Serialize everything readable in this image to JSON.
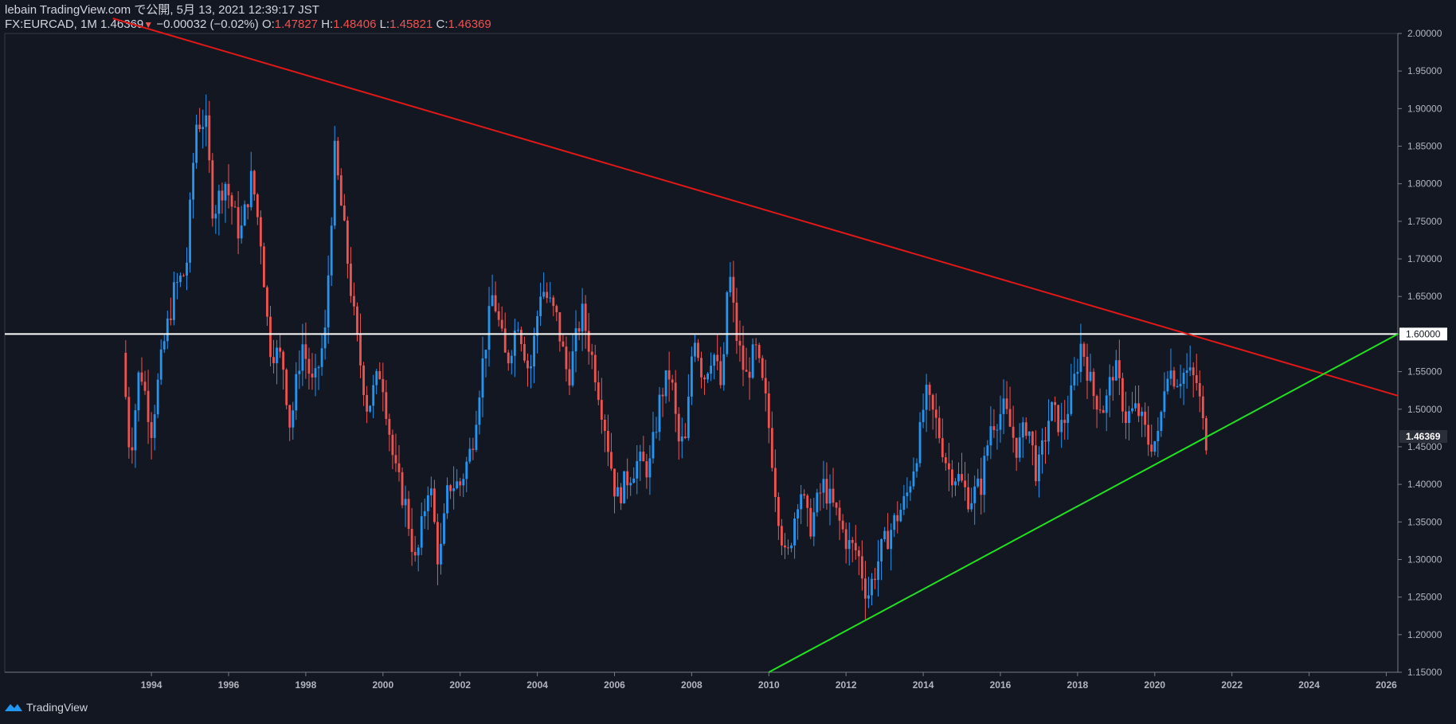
{
  "header": {
    "line1": "lebain TradingView.com で公開, 5月 13, 2021 12:39:17 JST",
    "symbol": "FX:EURCAD, 1M",
    "last": "1.46369",
    "change": "−0.00032 (−0.02%)",
    "o_label": "O:",
    "o": "1.47827",
    "h_label": "H:",
    "h": "1.48406",
    "l_label": "L:",
    "l": "1.45821",
    "c_label": "C:",
    "c": "1.46369"
  },
  "footer": {
    "brand": "TradingView"
  },
  "colors": {
    "background": "#131722",
    "up": "#2196f3",
    "down": "#ef5350",
    "resistance": "#e01818",
    "support": "#22e022",
    "level": "#ffffff"
  },
  "chart_data": {
    "type": "candlestick",
    "x_ticks": [
      "1994",
      "1996",
      "1998",
      "2000",
      "2002",
      "2004",
      "2006",
      "2008",
      "2010",
      "2012",
      "2014",
      "2016",
      "2018",
      "2020",
      "2022",
      "2024",
      "2026"
    ],
    "y_ticks": [
      "2.00000",
      "1.95000",
      "1.90000",
      "1.85000",
      "1.80000",
      "1.75000",
      "1.70000",
      "1.65000",
      "1.60000",
      "1.55000",
      "1.50000",
      "1.45000",
      "1.40000",
      "1.35000",
      "1.30000",
      "1.25000",
      "1.20000",
      "1.15000"
    ],
    "ylim": [
      1.15,
      2.0
    ],
    "xlim": [
      1990.2,
      2026.3
    ],
    "last_price_label": "1.46369",
    "level_label": "1.60000",
    "level": 1.6,
    "resistance_line": [
      [
        1993.0,
        2.02
      ],
      [
        2026.3,
        1.518
      ]
    ],
    "support_line": [
      [
        2010.0,
        1.15
      ],
      [
        2026.3,
        1.6
      ]
    ],
    "anchors": [
      [
        1993.25,
        1.575
      ],
      [
        1993.45,
        1.435
      ],
      [
        1993.7,
        1.56
      ],
      [
        1994.0,
        1.475
      ],
      [
        1994.3,
        1.58
      ],
      [
        1994.6,
        1.66
      ],
      [
        1994.9,
        1.685
      ],
      [
        1995.15,
        1.88
      ],
      [
        1995.4,
        1.885
      ],
      [
        1995.6,
        1.76
      ],
      [
        1995.9,
        1.805
      ],
      [
        1996.3,
        1.73
      ],
      [
        1996.6,
        1.81
      ],
      [
        1996.85,
        1.72
      ],
      [
        1997.05,
        1.585
      ],
      [
        1997.4,
        1.565
      ],
      [
        1997.6,
        1.475
      ],
      [
        1997.9,
        1.59
      ],
      [
        1998.2,
        1.525
      ],
      [
        1998.5,
        1.6
      ],
      [
        1998.75,
        1.84
      ],
      [
        1999.0,
        1.735
      ],
      [
        1999.3,
        1.6
      ],
      [
        1999.6,
        1.5
      ],
      [
        1999.95,
        1.555
      ],
      [
        2000.3,
        1.42
      ],
      [
        2000.6,
        1.37
      ],
      [
        2000.85,
        1.29
      ],
      [
        2001.2,
        1.41
      ],
      [
        2001.45,
        1.29
      ],
      [
        2001.7,
        1.4
      ],
      [
        2002.0,
        1.4
      ],
      [
        2002.3,
        1.45
      ],
      [
        2002.55,
        1.55
      ],
      [
        2002.85,
        1.655
      ],
      [
        2003.2,
        1.56
      ],
      [
        2003.5,
        1.62
      ],
      [
        2003.8,
        1.545
      ],
      [
        2004.1,
        1.665
      ],
      [
        2004.5,
        1.62
      ],
      [
        2004.8,
        1.54
      ],
      [
        2005.15,
        1.63
      ],
      [
        2005.5,
        1.55
      ],
      [
        2005.75,
        1.48
      ],
      [
        2006.05,
        1.38
      ],
      [
        2006.35,
        1.41
      ],
      [
        2006.6,
        1.43
      ],
      [
        2006.9,
        1.42
      ],
      [
        2007.2,
        1.52
      ],
      [
        2007.45,
        1.55
      ],
      [
        2007.65,
        1.455
      ],
      [
        2007.85,
        1.455
      ],
      [
        2008.05,
        1.61
      ],
      [
        2008.3,
        1.54
      ],
      [
        2008.55,
        1.58
      ],
      [
        2008.8,
        1.52
      ],
      [
        2008.95,
        1.695
      ],
      [
        2009.15,
        1.6
      ],
      [
        2009.4,
        1.54
      ],
      [
        2009.65,
        1.58
      ],
      [
        2009.95,
        1.5
      ],
      [
        2010.2,
        1.38
      ],
      [
        2010.45,
        1.29
      ],
      [
        2010.8,
        1.4
      ],
      [
        2011.05,
        1.34
      ],
      [
        2011.4,
        1.4
      ],
      [
        2011.75,
        1.36
      ],
      [
        2012.05,
        1.32
      ],
      [
        2012.3,
        1.31
      ],
      [
        2012.55,
        1.25
      ],
      [
        2012.9,
        1.31
      ],
      [
        2013.25,
        1.35
      ],
      [
        2013.55,
        1.38
      ],
      [
        2013.9,
        1.46
      ],
      [
        2014.05,
        1.52
      ],
      [
        2014.35,
        1.48
      ],
      [
        2014.65,
        1.42
      ],
      [
        2014.9,
        1.41
      ],
      [
        2015.2,
        1.38
      ],
      [
        2015.5,
        1.4
      ],
      [
        2015.75,
        1.48
      ],
      [
        2016.1,
        1.5
      ],
      [
        2016.45,
        1.445
      ],
      [
        2016.7,
        1.485
      ],
      [
        2016.95,
        1.41
      ],
      [
        2017.3,
        1.5
      ],
      [
        2017.6,
        1.475
      ],
      [
        2017.85,
        1.52
      ],
      [
        2018.1,
        1.59
      ],
      [
        2018.4,
        1.52
      ],
      [
        2018.7,
        1.5
      ],
      [
        2018.95,
        1.56
      ],
      [
        2019.25,
        1.49
      ],
      [
        2019.55,
        1.5
      ],
      [
        2019.85,
        1.455
      ],
      [
        2020.1,
        1.46
      ],
      [
        2020.3,
        1.56
      ],
      [
        2020.55,
        1.54
      ],
      [
        2020.8,
        1.55
      ],
      [
        2021.1,
        1.535
      ],
      [
        2021.3,
        1.46
      ]
    ]
  }
}
